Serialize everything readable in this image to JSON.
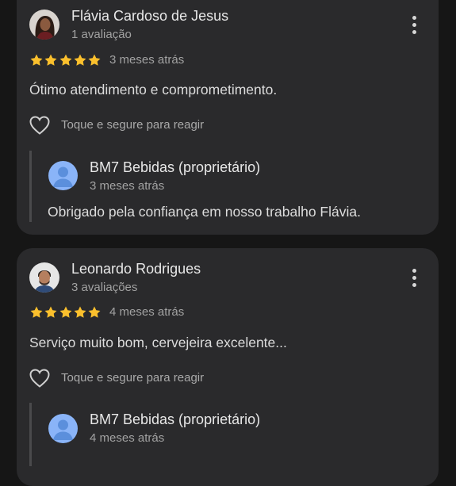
{
  "reviews": [
    {
      "reviewer_name": "Flávia Cardoso de Jesus",
      "review_count": "1 avaliação",
      "rating": 5,
      "age": "3 meses atrás",
      "text": "Ótimo atendimento e comprometimento.",
      "react_label": "Toque e segure para reagir",
      "owner_reply": {
        "owner_name": "BM7 Bebidas (proprietário)",
        "age": "3 meses atrás",
        "text": "Obrigado pela confiança em nosso trabalho Flávia."
      }
    },
    {
      "reviewer_name": "Leonardo Rodrigues",
      "review_count": "3 avaliações",
      "rating": 5,
      "age": "4 meses atrás",
      "text": "Serviço muito bom, cervejeira excelente...",
      "react_label": "Toque e segure para reagir",
      "owner_reply": {
        "owner_name": "BM7 Bebidas (proprietário)",
        "age": "4 meses atrás"
      }
    }
  ],
  "icons": {
    "star": "star-icon",
    "heart": "heart-outline-icon",
    "menu": "more-vert-icon",
    "avatar": "person-avatar-icon"
  },
  "colors": {
    "background": "#161616",
    "card": "#2a2a2c",
    "star": "#fbc02d",
    "owner_avatar": "#8ab4f8",
    "primary_text": "#e8e8e8",
    "secondary_text": "#a2a2a2"
  }
}
